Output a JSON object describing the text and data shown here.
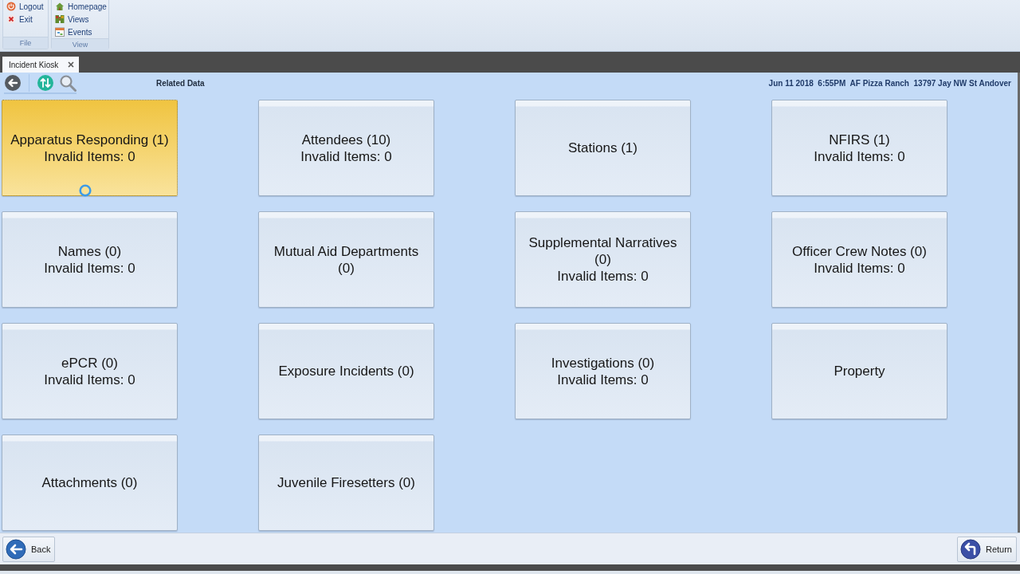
{
  "ribbon": {
    "groups": [
      {
        "label": "File",
        "items": [
          {
            "label": "Logout"
          },
          {
            "label": "Exit"
          }
        ]
      },
      {
        "label": "View",
        "items": [
          {
            "label": "Homepage"
          },
          {
            "label": "Views"
          },
          {
            "label": "Events"
          }
        ]
      }
    ]
  },
  "tabs": [
    {
      "label": "Incident Kiosk",
      "selected": true
    }
  ],
  "toolbar": {
    "title": "Related Data",
    "incident_info": "Jun 11 2018  6:55PM  AF Pizza Ranch  13797 Jay NW St Andover"
  },
  "tiles": [
    {
      "title": "Apparatus Responding (1)",
      "status": "Invalid Items: 0",
      "selected": true
    },
    {
      "title": "Attendees (10)",
      "status": "Invalid Items: 0",
      "selected": false
    },
    {
      "title": "Stations (1)",
      "selected": false
    },
    {
      "title": "NFIRS (1)",
      "status": "Invalid Items: 0",
      "selected": false
    },
    {
      "title": "Names (0)",
      "status": "Invalid Items: 0",
      "selected": false
    },
    {
      "title": "Mutual Aid Departments (0)",
      "selected": false
    },
    {
      "title": "Supplemental Narratives (0)",
      "status": "Invalid Items: 0",
      "selected": false
    },
    {
      "title": "Officer Crew Notes (0)",
      "status": "Invalid Items: 0",
      "selected": false
    },
    {
      "title": "ePCR (0)",
      "status": "Invalid Items: 0",
      "selected": false
    },
    {
      "title": "Exposure Incidents (0)",
      "selected": false
    },
    {
      "title": "Investigations (0)",
      "status": "Invalid Items: 0",
      "selected": false
    },
    {
      "title": "Property",
      "selected": false
    },
    {
      "title": "Attachments (0)",
      "selected": false
    },
    {
      "title": "Juvenile Firesetters (0)",
      "selected": false
    }
  ],
  "footer": {
    "back": "Back",
    "return": "Return"
  }
}
